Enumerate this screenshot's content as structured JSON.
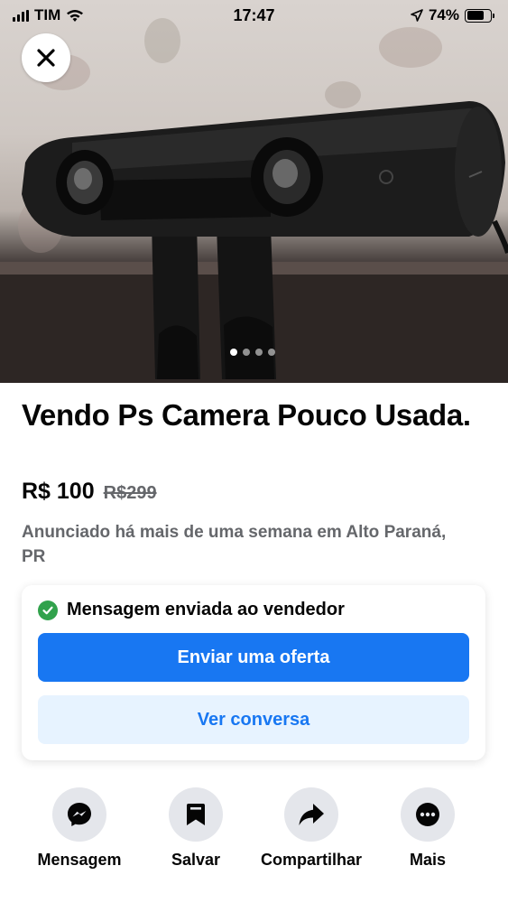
{
  "status_bar": {
    "carrier": "TIM",
    "time": "17:47",
    "battery": "74%",
    "battery_level": 0.74
  },
  "photo": {
    "carousel_count": 4,
    "carousel_active": 1
  },
  "listing": {
    "title": "Vendo Ps Camera Pouco Usada.",
    "price": "R$ 100",
    "old_price": "R$299",
    "meta": "Anunciado há mais de uma semana em Alto Paraná, PR"
  },
  "card": {
    "sent_message": "Mensagem enviada ao vendedor",
    "offer_button": "Enviar uma oferta",
    "view_button": "Ver conversa"
  },
  "actions": [
    {
      "label": "Mensagem",
      "icon": "messenger-icon"
    },
    {
      "label": "Salvar",
      "icon": "bookmark-icon"
    },
    {
      "label": "Compartilhar",
      "icon": "share-icon"
    },
    {
      "label": "Mais",
      "icon": "more-icon"
    }
  ],
  "colors": {
    "accent": "#1877f2",
    "accent_light": "#e7f3ff",
    "success": "#31a24c",
    "muted_text": "#65676b"
  }
}
